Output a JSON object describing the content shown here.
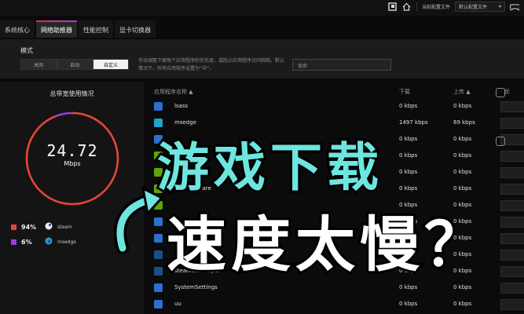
{
  "topbar": {
    "profile_label": "当前配置文件",
    "profile_value": "默认配置文件",
    "icons": [
      "note-icon",
      "home-icon",
      "gamepad-icon"
    ]
  },
  "tabs": [
    {
      "label": "系统核心",
      "active": false
    },
    {
      "label": "网络助推器",
      "active": true
    },
    {
      "label": "性能控制",
      "active": false
    },
    {
      "label": "显卡切换器",
      "active": false
    }
  ],
  "mode": {
    "title": "模式",
    "options": [
      "关闭",
      "自动",
      "自定义"
    ],
    "selected": "自定义",
    "description": "手动调整下面每个应用程序的优先级，或阻止应用程序访问网络。默认情况下，所有应用程序设置为“中”。",
    "search_placeholder": "搜索"
  },
  "usage": {
    "title": "总带宽使用情况",
    "speed": "24.72",
    "unit": "Mbps",
    "legend": [
      {
        "pct": "94%",
        "name": "steam",
        "color": "#e8452c"
      },
      {
        "pct": "6%",
        "name": "msedge",
        "color": "#9b3fd6"
      }
    ]
  },
  "table": {
    "headers": {
      "name": "应用程序名称",
      "download": "下载",
      "upload": "上传",
      "priority": "优"
    },
    "rows": [
      {
        "name": "lsass",
        "download": "0 kbps",
        "upload": "0 kbps",
        "icon": "app-icon",
        "color": "#2b6fd1"
      },
      {
        "name": "msedge",
        "download": "1497 kbps",
        "upload": "69 kbps",
        "icon": "edge-icon",
        "color": "#1fa3c9"
      },
      {
        "name": "",
        "download": "0 kbps",
        "upload": "0 kbps",
        "icon": "app-icon",
        "color": "#2b6fd1"
      },
      {
        "name": "",
        "download": "0 kbps",
        "upload": "0 kbps",
        "icon": "nvidia-icon",
        "color": "#5fa40a"
      },
      {
        "name": "",
        "download": "0 kbps",
        "upload": "0 kbps",
        "icon": "nvidia-icon",
        "color": "#5fa40a"
      },
      {
        "name": "NVIDIA Share",
        "download": "0 kbps",
        "upload": "0 kbps",
        "icon": "nvidia-icon",
        "color": "#5fa40a"
      },
      {
        "name": "",
        "download": "0 kbps",
        "upload": "0 kbps",
        "icon": "nvidia-icon",
        "color": "#5fa40a"
      },
      {
        "name": "",
        "download": "0 kbps",
        "upload": "0 kbps",
        "icon": "app-icon",
        "color": "#2b6fd1"
      },
      {
        "name": "",
        "download": "0 kbps",
        "upload": "0 kbps",
        "icon": "app-icon",
        "color": "#2b6fd1"
      },
      {
        "name": "",
        "download": "bps",
        "upload": "0 kbps",
        "icon": "steam-icon",
        "color": "#1b4f8a"
      },
      {
        "name": "steamwebhelper",
        "download": "0 kbps",
        "upload": "0 kbps",
        "icon": "steam-icon",
        "color": "#1b4f8a"
      },
      {
        "name": "SystemSettings",
        "download": "0 kbps",
        "upload": "0 kbps",
        "icon": "gear-icon",
        "color": "#2b6fd1"
      },
      {
        "name": "uu",
        "download": "0 kbps",
        "upload": "0 kbps",
        "icon": "uu-icon",
        "color": "#2b6fd1"
      }
    ]
  },
  "overlay": {
    "line1": "游戏下载",
    "line2": "速度太慢？"
  }
}
